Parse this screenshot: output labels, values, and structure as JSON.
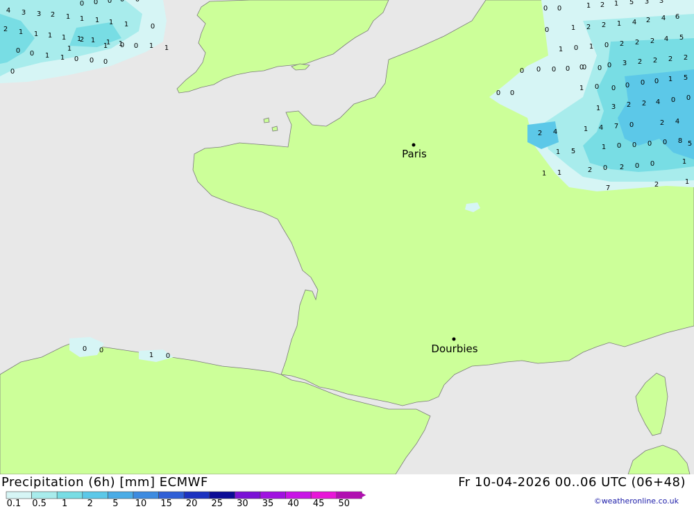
{
  "header": {
    "title": "Precipitation (6h) [mm] ECMWF",
    "timestamp": "Fr 10-04-2026 00..06 UTC (06+48)",
    "credit": "©weatheronline.co.uk"
  },
  "legend": {
    "ticks": [
      "0.1",
      "0.5",
      "1",
      "2",
      "5",
      "10",
      "15",
      "20",
      "25",
      "30",
      "35",
      "40",
      "45",
      "50"
    ],
    "colors": [
      "#d6f5f5",
      "#a8ecec",
      "#78dde4",
      "#5cc8e8",
      "#4aace6",
      "#3d8be0",
      "#2f5fd6",
      "#1c32c0",
      "#0b0b96",
      "#7a12d6",
      "#a012e0",
      "#c814e6",
      "#e816d8",
      "#b010b0"
    ]
  },
  "map": {
    "land_color": "#ccff99",
    "sea_color": "#e8e8e8",
    "cities": [
      {
        "name": "Paris"
      },
      {
        "name": "Dourbies"
      }
    ],
    "value_labels": [
      "4",
      "3",
      "3",
      "2",
      "1",
      "1",
      "1",
      "1",
      "1",
      "0",
      "2",
      "1",
      "1",
      "1",
      "1",
      "1",
      "1",
      "1",
      "0",
      "0",
      "1",
      "1",
      "2",
      "1",
      "1",
      "1",
      "0",
      "0",
      "1",
      "1",
      "0",
      "0",
      "0",
      "0",
      "0",
      "0",
      "0",
      "0",
      "0",
      "0",
      "0",
      "1",
      "2",
      "1",
      "5",
      "3",
      "3",
      "0",
      "0",
      "1",
      "2",
      "2",
      "1",
      "4",
      "2",
      "4",
      "6",
      "0",
      "1",
      "0",
      "1",
      "0",
      "2",
      "2",
      "2",
      "4",
      "5",
      "1",
      "0",
      "0",
      "0",
      "0",
      "3",
      "2",
      "2",
      "2",
      "2",
      "0",
      "0",
      "0",
      "0",
      "1",
      "5",
      "1",
      "3",
      "2",
      "2",
      "4",
      "0",
      "0",
      "2",
      "4",
      "1",
      "4",
      "7",
      "0",
      "2",
      "4",
      "5",
      "1",
      "5",
      "1",
      "0",
      "0",
      "0",
      "0",
      "8",
      "2",
      "0",
      "2",
      "0",
      "0",
      "1",
      "1",
      "1",
      "7",
      "2",
      "1",
      "0",
      "0",
      "1",
      "0",
      "0",
      "0",
      "0",
      "0",
      "0"
    ]
  }
}
